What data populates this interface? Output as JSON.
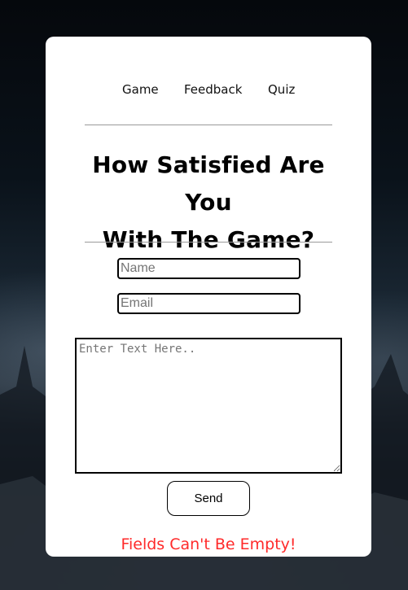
{
  "nav": {
    "items": [
      {
        "label": "Game"
      },
      {
        "label": "Feedback"
      },
      {
        "label": "Quiz"
      }
    ]
  },
  "heading": {
    "line1": "How Satisfied Are You",
    "line2": "With The Game?"
  },
  "form": {
    "name_placeholder": "Name",
    "email_placeholder": "Email",
    "message_placeholder": "Enter Text Here..",
    "send_label": "Send",
    "error_message": "Fields Can't Be Empty!"
  },
  "colors": {
    "card_background": "#ffffff",
    "error_text": "#ff2a2a",
    "divider": "#9a9a9a"
  }
}
